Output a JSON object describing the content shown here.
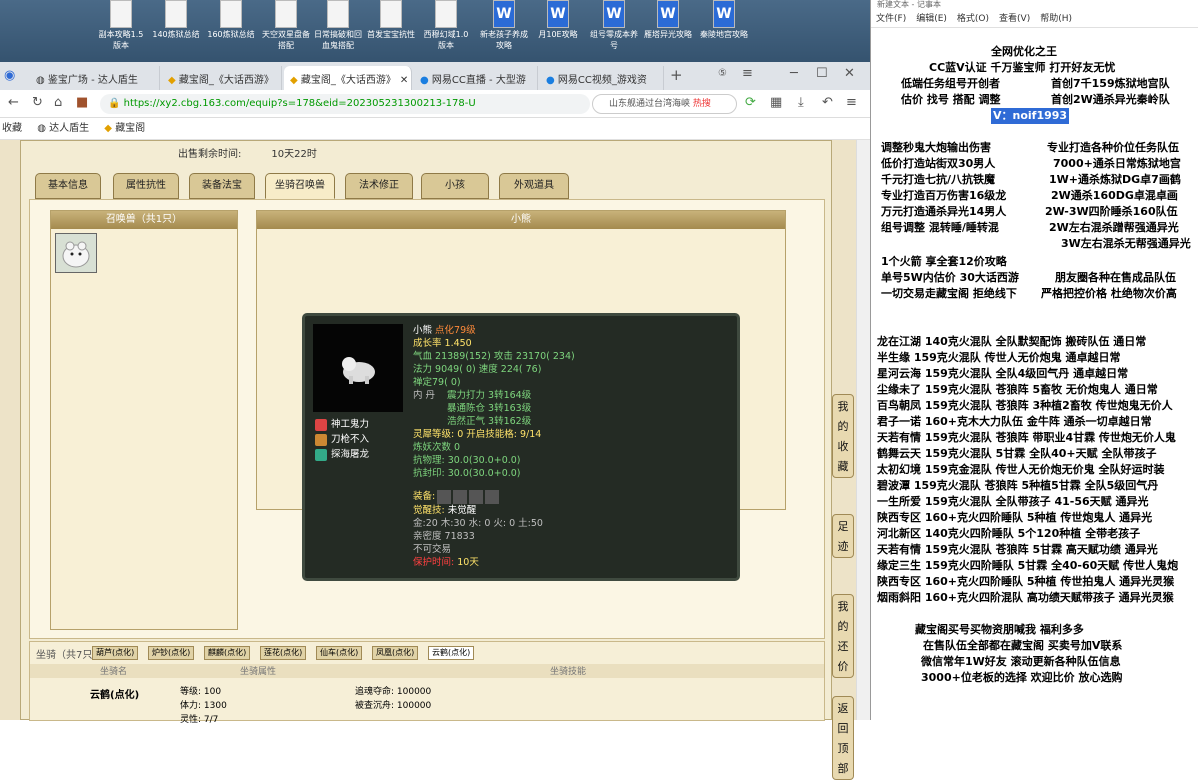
{
  "desktop_icons": [
    {
      "label": "副本攻略1.5版本",
      "word": false
    },
    {
      "label": "140炼狱总结",
      "word": false
    },
    {
      "label": "160炼狱总结",
      "word": false
    },
    {
      "label": "天空双星盘备搭配",
      "word": false
    },
    {
      "label": "日常搞破和回血鬼搭配",
      "word": false
    },
    {
      "label": "首发宝宝抗性",
      "word": false
    },
    {
      "label": "西穆幻域1.0版本",
      "word": false
    },
    {
      "label": "新老孩子养成攻略",
      "word": true
    },
    {
      "label": "月10E攻略",
      "word": true
    },
    {
      "label": "组号零成本养号",
      "word": true
    },
    {
      "label": "雁塔异光攻略",
      "word": true
    },
    {
      "label": "秦陵地宫攻略",
      "word": true
    }
  ],
  "tabs": [
    "鉴宝广场 - 达人盾生",
    "藏宝阁_《大话西游》",
    "藏宝阁_《大话西游》",
    "网易CC直播 - 大型游",
    "网易CC视频_游戏资"
  ],
  "address": {
    "url": "https://xy2.cbg.163.com/equip?s=178&eid=202305231300213-178-U",
    "search_placeholder": "山东舰通过台湾海峡",
    "hot": "热搜"
  },
  "bookmarks": [
    "收藏",
    "达人盾生",
    "藏宝阁"
  ],
  "panel": {
    "expiry_label": "出售剩余时间:",
    "expiry_value": "10天22时",
    "tabs": [
      "基本信息",
      "属性抗性",
      "装备法宝",
      "坐骑召唤兽",
      "法术修正",
      "小孩",
      "外观道具"
    ],
    "summons_header": "召唤兽（共1只）",
    "detail_header": "小熊",
    "card": {
      "name": "小熊",
      "name_tag": "点化79级",
      "growth": "成长率 1.450",
      "hp_label": "气血",
      "hp_val": "21389(152)",
      "atk_label": "攻击",
      "atk_val": "23170( 234)",
      "mp_label": "法力",
      "mp_val": "9049( 0)",
      "spd_label": "速度",
      "spd_val": "224( 76)",
      "zen_label": "禅定",
      "zen_val": "79( 0)",
      "dan_label": "内   丹",
      "dan1": "震力打力 3转164级",
      "dan2": "暴通陈仓 3转163级",
      "dan3": "浩然正气 3转162级",
      "skills": [
        "神工鬼力",
        "刀枪不入",
        "探海屠龙"
      ],
      "soul": "灵犀等级: 0 开启技能格: 9/14",
      "refine": "炼妖次数 0",
      "res1": "抗物理: 30.0(30.0+0.0)",
      "res2": "抗封印: 30.0(30.0+0.0)",
      "equip_label": "装备:",
      "awaken": "觉醒技:",
      "awaken_val": "未觉醒",
      "elements": "金:20 木:30 水: 0 火: 0 土:50",
      "intimacy": "亲密度 71833",
      "notrade": "不可交易",
      "protect_label": "保护时间:",
      "protect_val": "10天"
    },
    "mounts": {
      "header": "坐骑（共7只）",
      "tabs": [
        "葫芦(点化)",
        "炉钞(点化)",
        "麒麟(点化)",
        "莲花(点化)",
        "仙车(点化)",
        "凤凰(点化)",
        "云鹤(点化)"
      ],
      "col_name": "坐骑名",
      "col_attr": "坐骑属性",
      "col_skill": "坐骑技能",
      "row_name": "云鹤(点化)",
      "attrs": [
        "等级: 100",
        "体力: 1300",
        "灵性: 7/7"
      ],
      "skill_attrs": [
        "追魂夺命: 100000",
        "被查沉舟: 100000"
      ]
    },
    "side_buttons": [
      "我的收藏",
      "足迹",
      "我的还价",
      "返回顶部"
    ]
  },
  "notepad": {
    "title": "新建文本 - 记事本",
    "menu": [
      "文件(F)",
      "编辑(E)",
      "格式(O)",
      "查看(V)",
      "帮助(H)"
    ],
    "lines": [
      "全网优化之王",
      "CC蓝V认证 千万鉴宝师 打开好友无忧",
      "低端任务组号开创者",
      "首创7千159炼狱地宫队",
      "估价 找号 搭配 调整",
      "首创2W通杀异光秦岭队",
      "V：noif1993",
      "调整秒鬼大炮输出伤害",
      "专业打造各种价位任务队伍",
      "低价打造站街双30男人",
      "7000+通杀日常炼狱地宫",
      "千元打造七抗/八抗铁魔",
      "1W+通杀炼狱DG卓7画鹤",
      "专业打造百万伤害16级龙",
      "2W通杀160DG卓混卓画",
      "万元打造通杀异光14男人",
      "2W-3W四阶睡杀160队伍",
      "组号调整 混转睡/睡转混",
      "2W左右混杀蹭帮强通异光",
      "3W左右混杀无帮强通异光",
      "1个火箭 享全套12价攻略",
      "单号5W内估价 30大话西游",
      "朋友圈各种在售成品队伍",
      "一切交易走藏宝阁 拒绝线下",
      "严格把控价格 杜绝物次价高",
      "龙在江湖 140克火混队 全队默契配饰 搬砖队伍 通日常",
      "半生缘      159克火混队 传世人无价炮鬼 通卓越日常",
      "星河云海 159克火混队 全队4级回气丹 通卓越日常",
      "尘缘未了 159克火混队 苍狼阵 5畜牧 无价炮鬼人 通日常",
      "百鸟朝凤 159克火混队 苍狼阵 3种植2畜牧 传世炮鬼无价人",
      "君子一诺 160+克木大力队伍 金牛阵 通杀一切卓越日常",
      "天若有情 159克火混队 苍狼阵 带职业4甘霖 传世炮无价人鬼",
      "鹤舞云天 159克火混队 5甘霖 全队40+天赋 全队带孩子",
      "太初幻境 159克金混队 传世人无价炮无价鬼 全队好运时装",
      "碧波潭      159克火混队 苍狼阵 5种植5甘霖 全队5级回气丹",
      "一生所爱 159克火混队 全队带孩子 41-56天赋 通异光",
      "陕西专区 160+克火四阶睡队 5种植 传世炮鬼人 通异光",
      "河北新区 140克火四阶睡队 5个120种植 全带老孩子",
      "天若有情 159克火混队 苍狼阵 5甘霖 高天赋功绩 通异光",
      "缘定三生 159克火四阶睡队 5甘霖 全40-60天赋 传世人鬼炮",
      "陕西专区 160+克火四阶睡队 5种植 传世拍鬼人 通异光灵猴",
      "烟雨斜阳 160+克火四阶混队 高功绩天赋带孩子 通异光灵猴",
      "藏宝阁买号买物资朋喊我 福利多多",
      "在售队伍全部都在藏宝阁 买卖号加V联系",
      "微信常年1W好友 滚动更新各种队伍信息",
      "3000+位老板的选择 欢迎比价 放心选购"
    ]
  },
  "colors": {
    "accent_link": "#2f6bd6",
    "card_bg": "#242b24",
    "panel_bg": "#f3ecd3"
  }
}
